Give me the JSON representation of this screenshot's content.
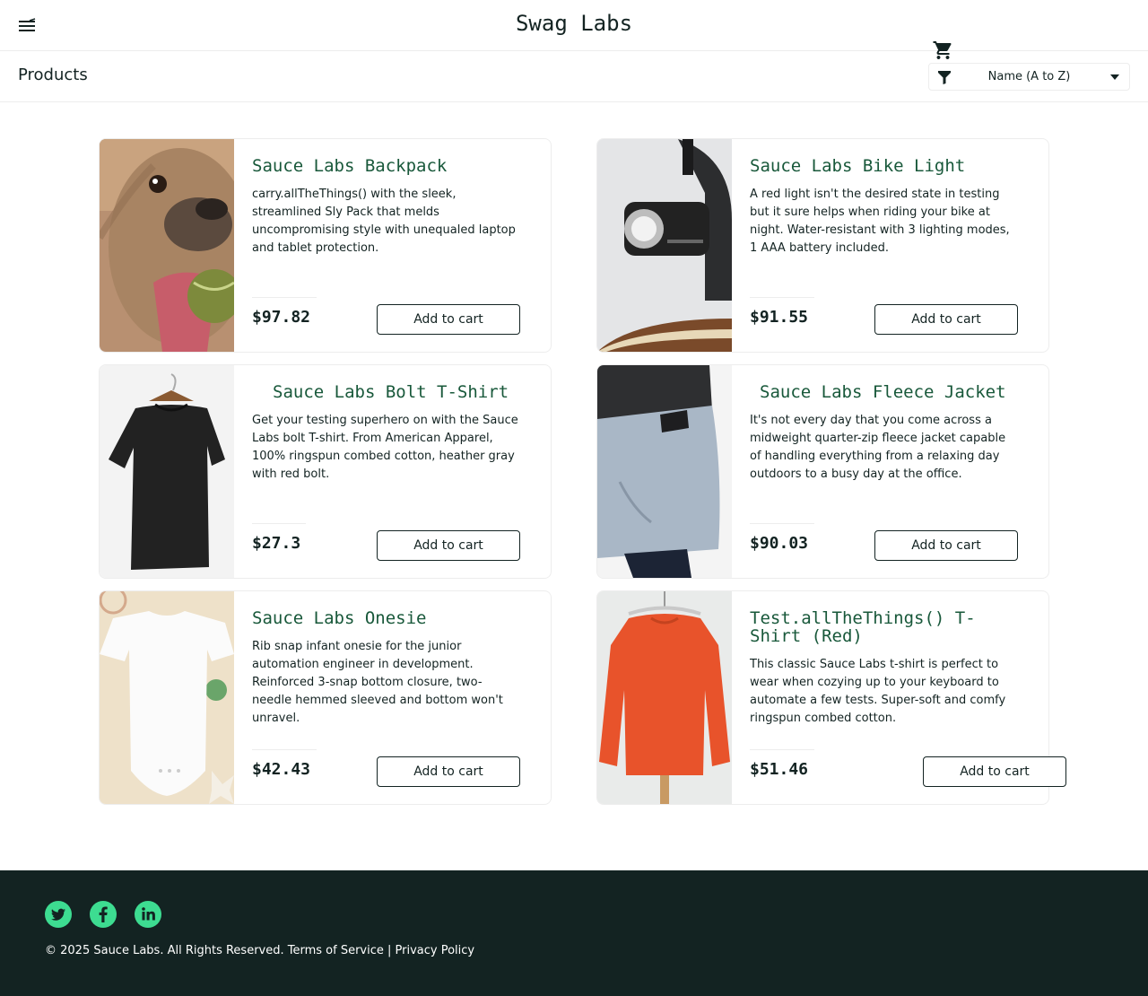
{
  "header": {
    "app_title": "Swag Labs",
    "menu_icon": "hamburger-menu-icon",
    "cart_icon": "shopping-cart-icon"
  },
  "subheader": {
    "title": "Products",
    "sort": {
      "selected": "Name (A to Z)",
      "icon": "filter-icon"
    }
  },
  "products": [
    {
      "name": "Sauce Labs Backpack",
      "description": "carry.allTheThings() with the sleek, streamlined Sly Pack that melds uncompromising style with unequaled laptop and tablet protection.",
      "price": "$97.82",
      "button": "Add to cart",
      "image": "pug-with-tennis-ball"
    },
    {
      "name": "Sauce Labs Bike Light",
      "description": "A red light isn't the desired state in testing but it sure helps when riding your bike at night. Water-resistant with 3 lighting modes, 1 AAA battery included.",
      "price": "$91.55",
      "button": "Add to cart",
      "image": "bike-light"
    },
    {
      "name": "Sauce Labs Bolt T-Shirt",
      "description": "Get your testing superhero on with the Sauce Labs bolt T-shirt. From American Apparel, 100% ringspun combed cotton, heather gray with red bolt.",
      "price": "$27.3",
      "button": "Add to cart",
      "image": "black-t-shirt"
    },
    {
      "name": "Sauce Labs Fleece Jacket",
      "description": "It's not every day that you come across a midweight quarter-zip fleece jacket capable of handling everything from a relaxing day outdoors to a busy day at the office.",
      "price": "$90.03",
      "button": "Add to cart",
      "image": "fleece-jacket"
    },
    {
      "name": "Sauce Labs Onesie",
      "description": "Rib snap infant onesie for the junior automation engineer in development. Reinforced 3-snap bottom closure, two-needle hemmed sleeved and bottom won't unravel.",
      "price": "$42.43",
      "button": "Add to cart",
      "image": "white-onesie"
    },
    {
      "name": "Test.allTheThings() T-Shirt (Red)",
      "description": "This classic Sauce Labs t-shirt is perfect to wear when cozying up to your keyboard to automate a few tests. Super-soft and comfy ringspun combed cotton.",
      "price": "$51.46",
      "button": "Add to cart",
      "image": "red-sweatshirt"
    }
  ],
  "footer": {
    "social": [
      "twitter-icon",
      "facebook-icon",
      "linkedin-icon"
    ],
    "copyright": "© 2025 Sauce Labs. All Rights Reserved. Terms of Service | Privacy Policy"
  },
  "colors": {
    "brand_dark": "#132322",
    "product_name": "#18583a",
    "social_icon": "#3ddc91",
    "border": "#ededed"
  }
}
